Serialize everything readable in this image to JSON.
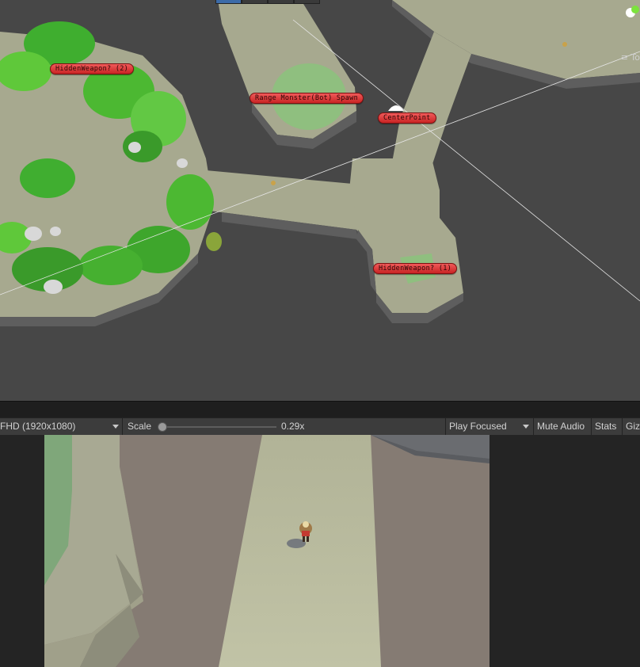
{
  "scene": {
    "labels": {
      "hidden_weapon_2": "HiddenWeapon? (2)",
      "range_spawn": "Range Monster(Bot) Spawn",
      "center_point": "CenterPoint",
      "hidden_weapon_1": "HiddenWeapon? (1)"
    },
    "overlay_text": "To",
    "colors": {
      "background": "#474747",
      "ground": "#a7a98f",
      "wall": "#5e5e5e",
      "label": "#e03a3a",
      "foliage": "#3fae2f"
    }
  },
  "toolbar": {
    "resolution": "FHD (1920x1080)",
    "scale_label": "Scale",
    "scale_value": "0.29x",
    "scale_fraction": 0.0,
    "play_mode": "Play Focused",
    "mute_audio": "Mute Audio",
    "stats": "Stats",
    "gizmos": "Giz"
  },
  "game": {
    "colors": {
      "path": "#bcbda2",
      "floor": "#857b73",
      "plateau": "#a8a993",
      "grass": "#7fa77a"
    }
  }
}
